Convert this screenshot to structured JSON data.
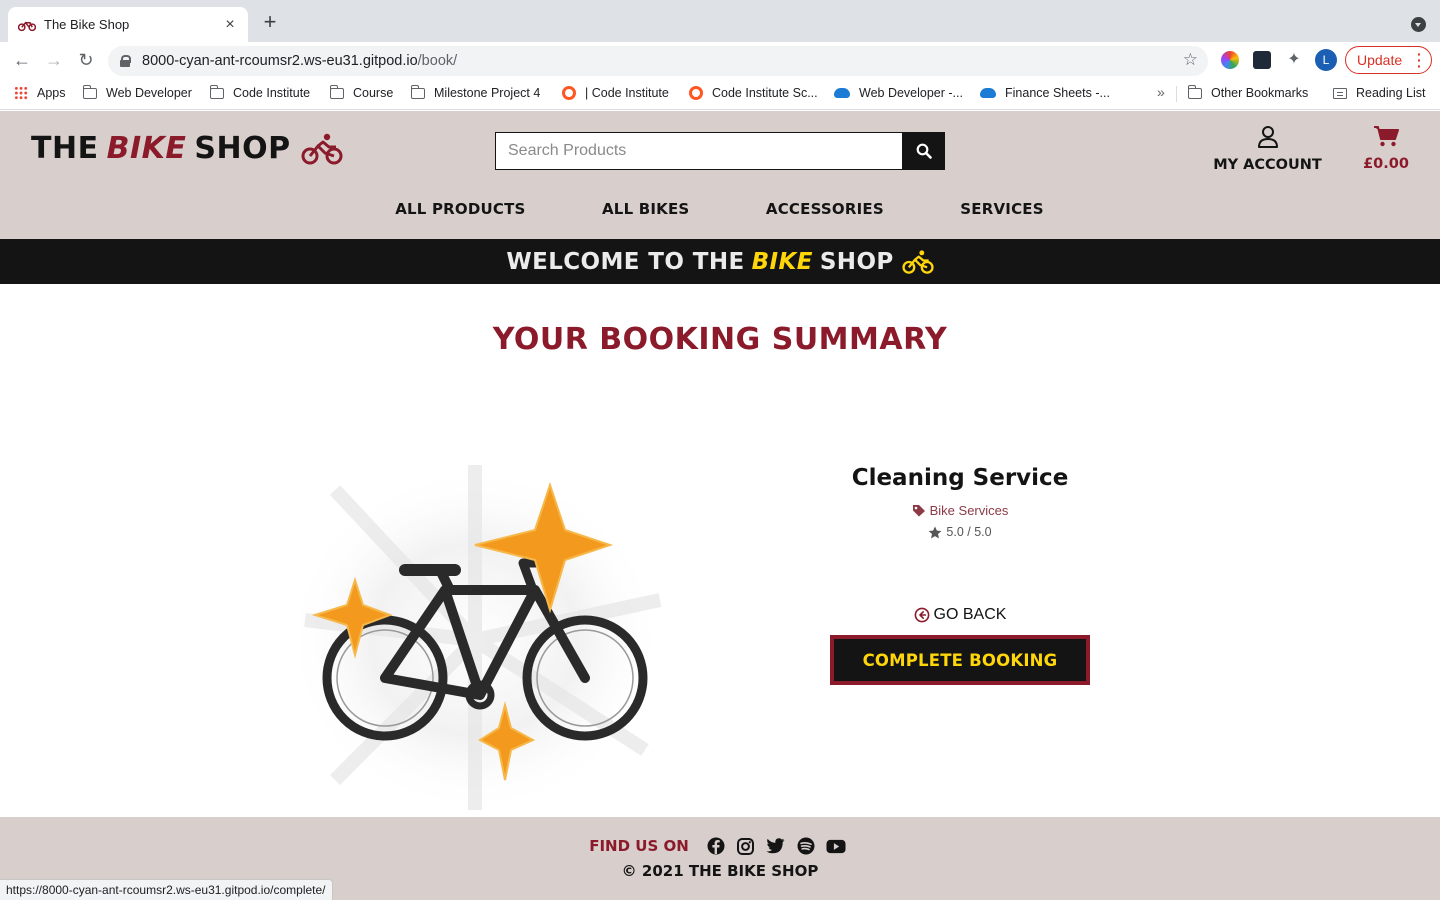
{
  "browser": {
    "tab_title": "The Bike Shop",
    "url_host": "8000-cyan-ant-rcoumsr2.ws-eu31.gitpod.io",
    "url_path": "/book/",
    "profile_initial": "L",
    "update_label": "Update",
    "bookmarks": [
      "Apps",
      "Web Developer",
      "Code Institute",
      "Course",
      "Milestone Project 4",
      "| Code Institute",
      "Code Institute Sc...",
      "Web Developer -...",
      "Finance Sheets -...",
      "Other Bookmarks",
      "Reading List"
    ],
    "bookmarks_more": "»",
    "status_url": "https://8000-cyan-ant-rcoumsr2.ws-eu31.gitpod.io/complete/"
  },
  "header": {
    "logo_the": "THE",
    "logo_bike": "BIKE",
    "logo_shop": "SHOP",
    "search_placeholder": "Search Products",
    "account_label": "MY ACCOUNT",
    "cart_total": "£0.00",
    "nav": [
      "ALL PRODUCTS",
      "ALL BIKES",
      "ACCESSORIES",
      "SERVICES"
    ]
  },
  "banner": {
    "prefix": "WELCOME TO THE",
    "bike": "BIKE",
    "shop": "SHOP"
  },
  "main": {
    "title": "YOUR BOOKING SUMMARY",
    "product": {
      "name": "Cleaning Service",
      "category": "Bike Services",
      "rating": "5.0 / 5.0"
    },
    "go_back": "GO BACK",
    "complete_booking": "COMPLETE BOOKING"
  },
  "footer": {
    "find_us": "FIND US ON",
    "social": [
      "facebook-icon",
      "instagram-icon",
      "twitter-icon",
      "spotify-icon",
      "youtube-icon"
    ],
    "copyright": "© 2021 THE BIKE SHOP"
  },
  "colors": {
    "brand_red": "#8b1a2a",
    "brand_yellow": "#ffd60a",
    "header_bg": "#d8cfcc",
    "dark": "#141414"
  }
}
